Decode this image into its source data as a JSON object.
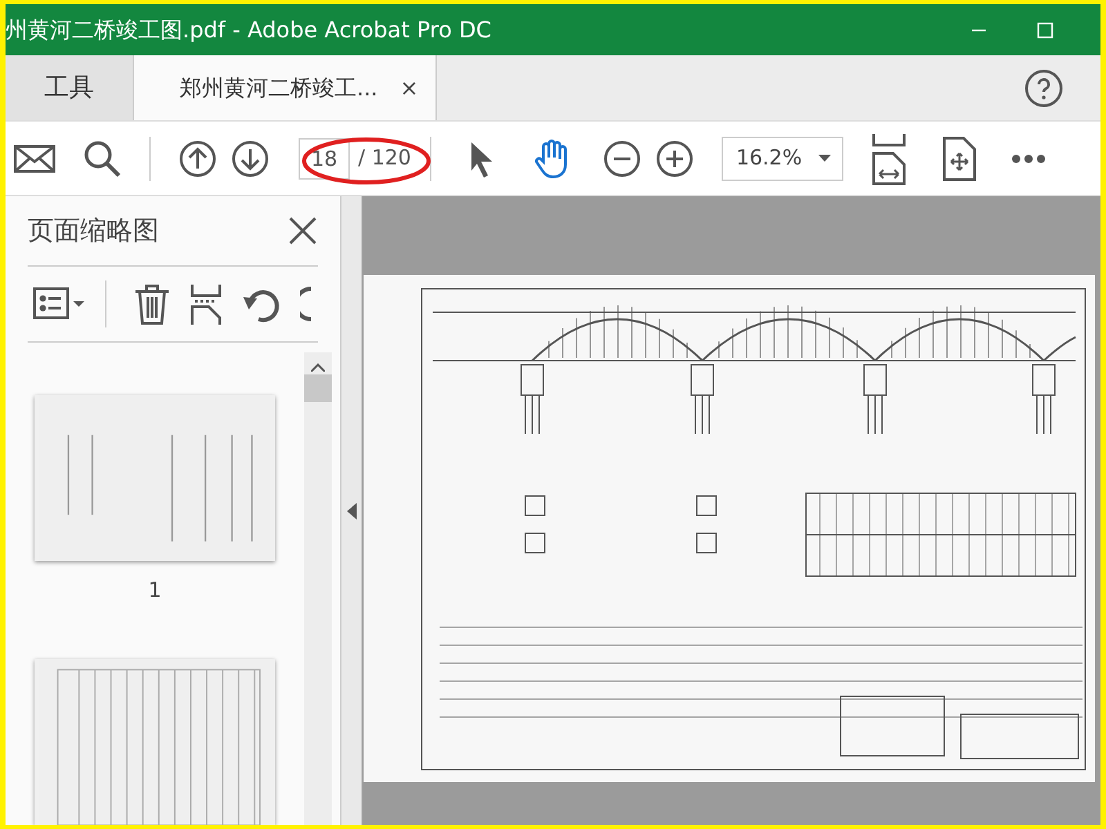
{
  "window": {
    "title": "州黄河二桥竣工图.pdf - Adobe Acrobat Pro DC"
  },
  "tabs": [
    {
      "label": "工具",
      "selected": false
    },
    {
      "label": "郑州黄河二桥竣工...",
      "selected": true,
      "close": "×"
    }
  ],
  "page_nav": {
    "current": "18",
    "total": "/ 120"
  },
  "tools": [
    {
      "kind": "select",
      "selected": false
    },
    {
      "kind": "hand",
      "selected": true
    }
  ],
  "zoom": {
    "value": "16.2%"
  },
  "thumbnail_panel": {
    "title": "页面缩略图",
    "thumbnails": [
      {
        "kind": "cover",
        "label": "1"
      },
      {
        "kind": "table"
      }
    ]
  }
}
